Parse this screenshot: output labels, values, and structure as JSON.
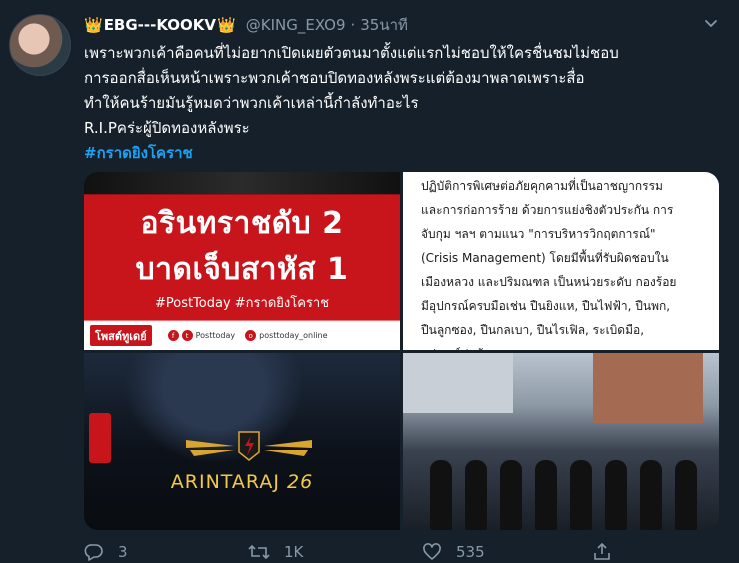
{
  "tweet": {
    "crown_left": "👑",
    "crown_right": "👑",
    "display_name": "EBG---KOOKV",
    "handle": "@KING_EXO9",
    "separator": "·",
    "timestamp": "35นาที",
    "lines": [
      "เพราะพวกเค้าคือคนที่ไม่อยากเปิดเผยตัวตนมาตั้งแต่แรกไม่ชอบให้ใครชื่นชมไม่ชอบ",
      "การออกสื่อเห็นหน้าเพราะพวกเค้าชอบปิดทองหลังพระแต่ต้องมาพลาดเพราะสื่อ",
      "ทำให้คนร้ายมันรู้หมดว่าพวกเค้าเหล่านี้กำลังทำอะไร",
      "R.I.Pคร่ะผู้ปิดทองหลังพระ"
    ],
    "hashtag": "#กราดยิงโคราช"
  },
  "media": {
    "image1": {
      "headline_line1": "อรินทราชดับ 2",
      "headline_line2": "บาดเจ็บสาหัส 1",
      "tags": "#PostToday #กราดยิงโคราช",
      "logo": "โพสต์ทูเดย์",
      "social_fb_icon": "f",
      "social_tw_icon": "t",
      "social_ig_icon": "o",
      "social_label_1": "Posttoday",
      "social_label_2": "posttoday_online"
    },
    "image2": {
      "lines": [
        "ปฏิบัติการพิเศษต่อภัยคุกคามที่เป็นอาชญากรรม",
        "และการก่อการร้าย ด้วยการแย่งชิงตัวประกัน การ",
        "จับกุม ฯลฯ ตามแนว \"การบริหารวิกฤตการณ์\"",
        "(Crisis Management) โดยมีพื้นที่รับผิดชอบใน",
        "เมืองหลวง และปริมณฑล เป็นหน่วยระดับ กองร้อย",
        "มีอุปกรณ์ครบมือเช่น ปืนยิงแห, ปืนไฟฟ้า, ปืนพก,",
        "ปืนลูกซอง, ปืนกลเบา, ปืนไรเฟิล, ระเบิดมือ,",
        "อุปกรณ์ต่อต้านการจลาจล ฯลฯ"
      ]
    },
    "image3": {
      "emblem_text": "ARINTARAJ",
      "emblem_number": "26"
    }
  },
  "actions": {
    "reply_count": "3",
    "retweet_count": "1K",
    "like_count": "535"
  },
  "colors": {
    "background": "#15202b",
    "link": "#1da1f2",
    "muted": "#8899a6"
  }
}
